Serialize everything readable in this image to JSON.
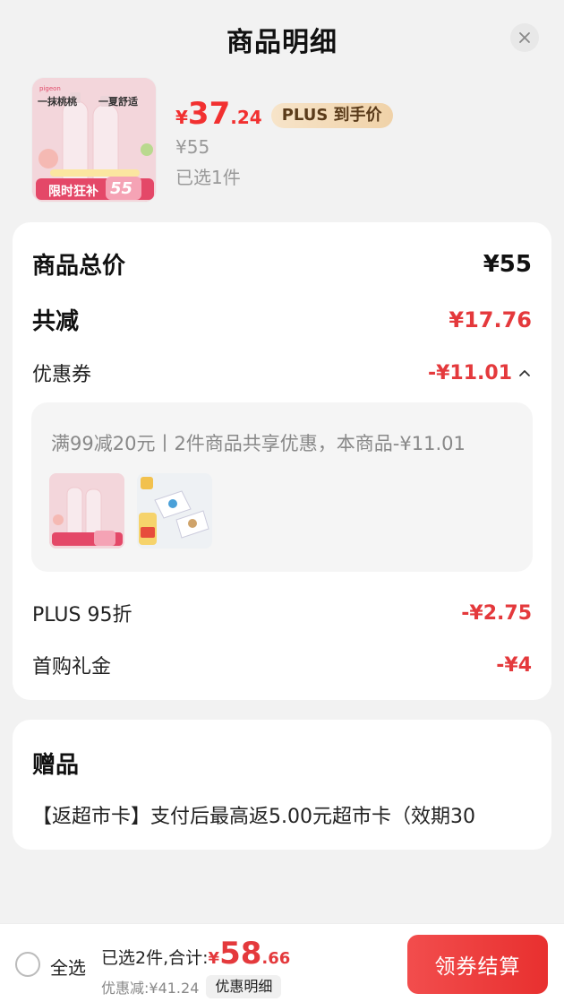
{
  "header": {
    "title": "商品明细",
    "close_icon": "close-icon"
  },
  "product": {
    "image_icon": "product-image",
    "image_text": {
      "line1": "一抹桃桃",
      "line2": "一夏舒适",
      "promo": "限时狂补",
      "promo_price": "55"
    },
    "price_symbol": "¥",
    "price_int": "37",
    "price_dec": ".24",
    "plus_tag": "PLUS 到手价",
    "original_price": "¥55",
    "selected": "已选1件"
  },
  "breakdown": {
    "total_label": "商品总价",
    "total_value": "¥55",
    "reduce_label": "共减",
    "reduce_value": "¥17.76",
    "coupon_label": "优惠券",
    "coupon_value": "-¥11.01",
    "coupon_desc": "满99减20元丨2件商品共享优惠，本商品-¥11.01",
    "plus_label": "PLUS 95折",
    "plus_value": "-¥2.75",
    "first_label": "首购礼金",
    "first_value": "-¥4",
    "thumbs": [
      "product-thumb-1",
      "product-thumb-2"
    ]
  },
  "gift": {
    "title": "赠品",
    "text": "【返超市卡】支付后最高返5.00元超市卡（效期30"
  },
  "bottom": {
    "select_all": "全选",
    "summary_label": "已选2件,合计:",
    "total_symbol": "¥",
    "total_int": "58",
    "total_dec": ".66",
    "discount_text": "优惠减:¥41.24",
    "detail_button": "优惠明细",
    "checkout_button": "领券结算"
  },
  "colors": {
    "accent_red": "#e4393c",
    "price_red": "#f23030",
    "plus_gold": "#f0d2a8",
    "background": "#f2f2f2"
  }
}
